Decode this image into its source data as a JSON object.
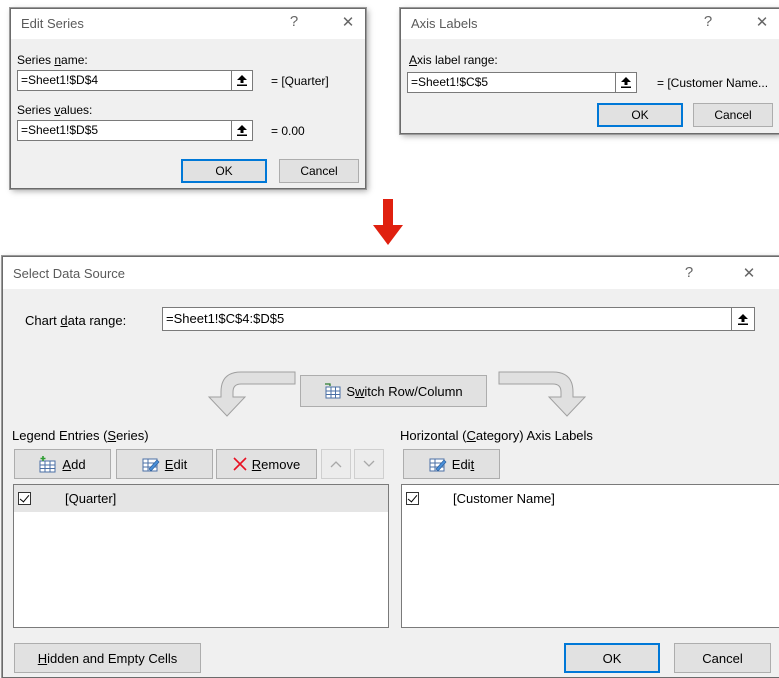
{
  "edit_series": {
    "title": "Edit Series",
    "help": "?",
    "close": "✕",
    "series_name_label": "Series name:",
    "series_name_value": "=Sheet1!$D$4",
    "series_name_result": "= [Quarter]",
    "series_values_label": "Series values:",
    "series_values_value": "=Sheet1!$D$5",
    "series_values_result": "= 0.00",
    "ok": "OK",
    "cancel": "Cancel"
  },
  "axis_labels": {
    "title": "Axis Labels",
    "help": "?",
    "close": "✕",
    "range_label": "Axis label range:",
    "range_value": "=Sheet1!$C$5",
    "range_result": "= [Customer Name...",
    "ok": "OK",
    "cancel": "Cancel"
  },
  "select_data": {
    "title": "Select Data Source",
    "help": "?",
    "close": "✕",
    "chart_range_label": "Chart data range:",
    "chart_range_value": "=Sheet1!$C$4:$D$5",
    "switch_label": "Switch Row/Column",
    "legend_title": "Legend Entries (Series)",
    "add_label": "Add",
    "edit_label": "Edit",
    "remove_label": "Remove",
    "series_items": [
      "[Quarter]"
    ],
    "axis_title": "Horizontal (Category) Axis Labels",
    "axis_edit_label": "Edit",
    "axis_items": [
      "[Customer Name]"
    ],
    "hidden_cells_label": "Hidden and Empty Cells",
    "ok": "OK",
    "cancel": "Cancel"
  },
  "colors": {
    "arrow": "#e0200f",
    "default_button": "#0078d7",
    "remove_x": "#e81123"
  }
}
